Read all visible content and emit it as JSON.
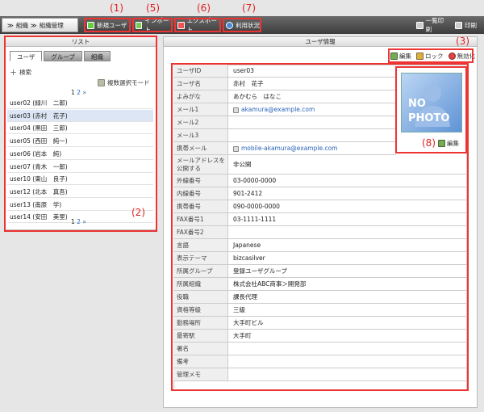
{
  "annotations": {
    "a1": "(1)",
    "a5": "(5)",
    "a6": "(6)",
    "a7": "(7)",
    "a2": "(2)",
    "a3": "(3)",
    "a8": "(8)"
  },
  "breadcrumb": {
    "item1": "組織",
    "item2": "組織管理"
  },
  "toolbar": {
    "new_user": "新規ユーザ",
    "import": "インポート",
    "export": "エクスポート",
    "usage": "利用状況",
    "print_list": "一覧印刷",
    "print": "印刷"
  },
  "list_panel": {
    "title": "リスト",
    "tabs": [
      "ユーザ",
      "グループ",
      "組織"
    ],
    "search": "検索",
    "multi_select": "複数選択モード",
    "pager_current": "1",
    "pager_links": "2 »",
    "users": [
      "user02 (緑川　二郎)",
      "user03 (赤村　花子)",
      "user04 (黒田　三郎)",
      "user05 (西田　純一)",
      "user06 (岩本　純)",
      "user07 (青木　一郎)",
      "user10 (東山　良子)",
      "user12 (北本　真吾)",
      "user13 (南原　学)",
      "user14 (安田　美里)"
    ],
    "selected_index": 1
  },
  "detail_panel": {
    "title": "ユーザ情報",
    "actions": {
      "edit": "編集",
      "lock": "ロック",
      "disable": "無効化"
    },
    "photo_text1": "NO",
    "photo_text2": "PHOTO",
    "photo_edit": "編集",
    "rows": [
      {
        "label": "ユーザID",
        "value": "user03"
      },
      {
        "label": "ユーザ名",
        "value": "赤村　花子"
      },
      {
        "label": "よみがな",
        "value": "あかむら　はなこ"
      },
      {
        "label": "メール1",
        "value": "akamura@example.com",
        "link": true
      },
      {
        "label": "メール2",
        "value": ""
      },
      {
        "label": "メール3",
        "value": ""
      },
      {
        "label": "携帯メール",
        "value": "mobile-akamura@example.com",
        "link": true
      },
      {
        "label": "メールアドレスを公開する",
        "value": "非公開",
        "tall": true
      },
      {
        "label": "外線番号",
        "value": "03-0000-0000"
      },
      {
        "label": "内線番号",
        "value": "901-2412"
      },
      {
        "label": "携帯番号",
        "value": "090-0000-0000"
      },
      {
        "label": "FAX番号1",
        "value": "03-1111-1111"
      },
      {
        "label": "FAX番号2",
        "value": ""
      },
      {
        "label": "言語",
        "value": "Japanese"
      },
      {
        "label": "表示テーマ",
        "value": "bizcasilver"
      },
      {
        "label": "所属グループ",
        "value": "登録ユーザグループ"
      },
      {
        "label": "所属組織",
        "value": "株式会社ABC商事＞開発部"
      },
      {
        "label": "役職",
        "value": "課長代理"
      },
      {
        "label": "資格等級",
        "value": "三級"
      },
      {
        "label": "勤務場所",
        "value": "大手町ビル"
      },
      {
        "label": "最寄駅",
        "value": "大手町"
      },
      {
        "label": "署名",
        "value": ""
      },
      {
        "label": "備考",
        "value": ""
      },
      {
        "label": "管理メモ",
        "value": ""
      }
    ]
  },
  "colors": {
    "accent": "#e33",
    "link": "#2a64b8",
    "selected_row": "#dce6f4"
  }
}
